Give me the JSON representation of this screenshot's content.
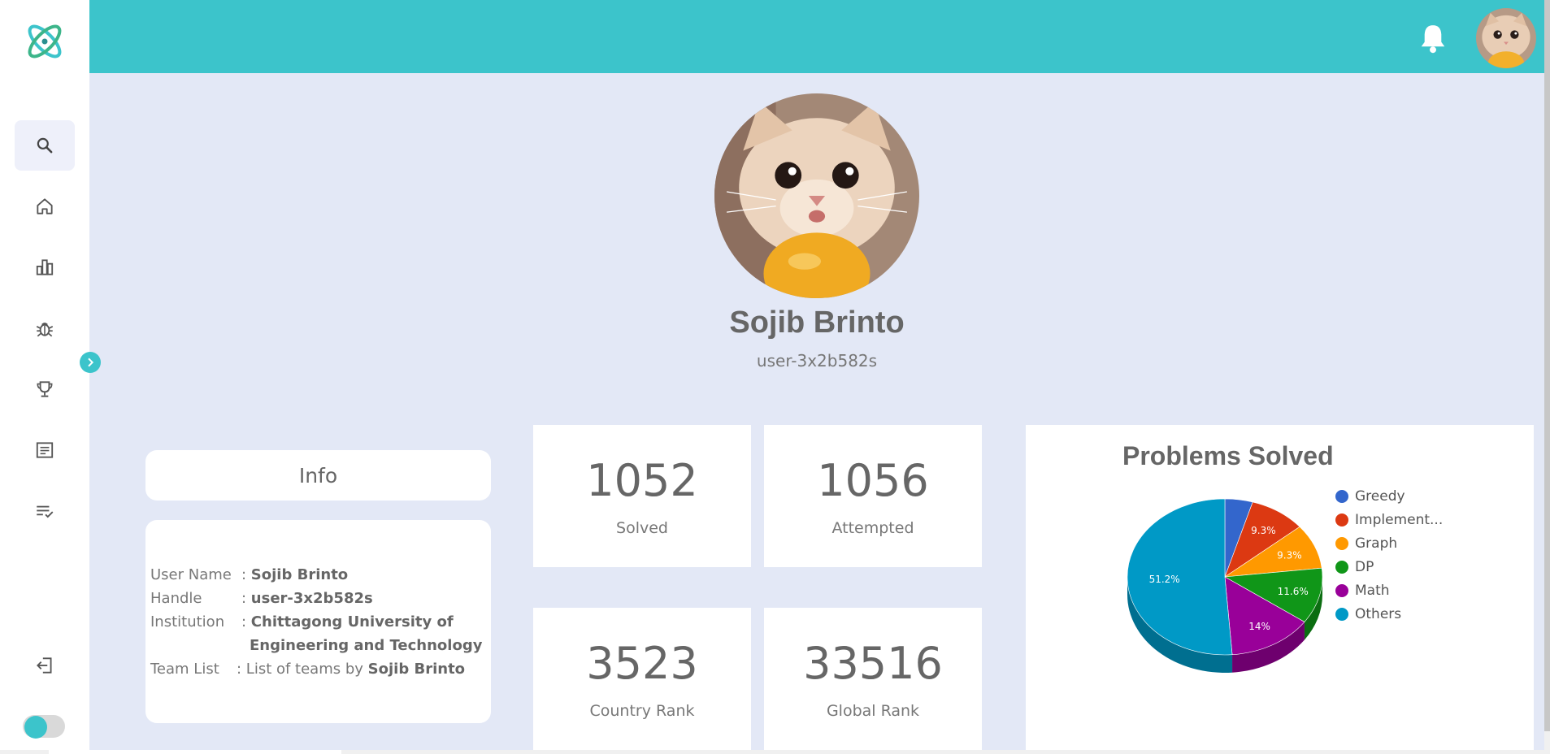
{
  "header": {
    "bell_icon": "bell-icon",
    "avatar": "user-avatar"
  },
  "sidebar": {
    "items": [
      {
        "name": "search",
        "icon": "search-icon"
      },
      {
        "name": "home",
        "icon": "home-icon"
      },
      {
        "name": "rankings",
        "icon": "bar-chart-icon"
      },
      {
        "name": "problems",
        "icon": "bug-icon"
      },
      {
        "name": "contests",
        "icon": "trophy-icon"
      },
      {
        "name": "blogs",
        "icon": "article-icon"
      },
      {
        "name": "submissions",
        "icon": "list-check-icon"
      }
    ],
    "logout_icon": "logout-icon",
    "expand_icon": "chevron-right-icon"
  },
  "profile": {
    "name": "Sojib Brinto",
    "handle": "user-3x2b582s"
  },
  "info": {
    "title": "Info",
    "user_name_label": "User Name",
    "user_name_value": "Sojib Brinto",
    "handle_label": "Handle",
    "handle_value": "user-3x2b582s",
    "institution_label": "Institution",
    "institution_value_line1": "Chittagong University of",
    "institution_value_line2": "Engineering and Technology",
    "team_list_label": "Team List",
    "team_list_text": "List of teams by",
    "team_list_owner": "Sojib Brinto"
  },
  "stats": {
    "solved": {
      "value": "1052",
      "label": "Solved"
    },
    "attempted": {
      "value": "1056",
      "label": "Attempted"
    },
    "country_rank": {
      "value": "3523",
      "label": "Country Rank"
    },
    "global_rank": {
      "value": "33516",
      "label": "Global Rank"
    }
  },
  "chart_data": {
    "type": "pie",
    "title": "Problems Solved",
    "categories": [
      "Greedy",
      "Implement...",
      "Graph",
      "DP",
      "Math",
      "Others"
    ],
    "values": [
      4.6,
      9.3,
      9.3,
      11.6,
      14,
      51.2
    ],
    "labels": [
      "",
      "9.3%",
      "9.3%",
      "11.6%",
      "14%",
      "51.2%"
    ],
    "colors": [
      "#3366cc",
      "#dc3912",
      "#ff9900",
      "#109618",
      "#990099",
      "#0099c6"
    ],
    "side_colors": [
      "#234a94",
      "#a1280c",
      "#b86f00",
      "#0b6d11",
      "#6e006e",
      "#006f90"
    ],
    "legend_position": "right"
  }
}
